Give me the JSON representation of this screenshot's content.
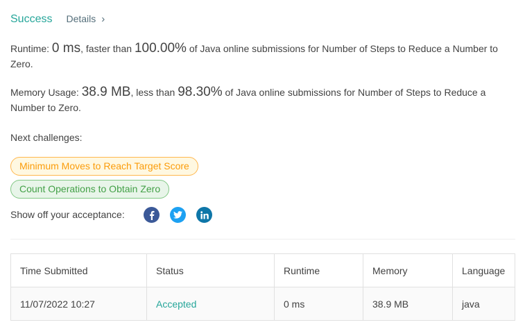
{
  "header": {
    "status": "Success",
    "details_label": "Details",
    "details_chevron": "›"
  },
  "runtime": {
    "label": "Runtime:",
    "value": "0 ms",
    "comparison": ", faster than",
    "percent": "100.00%",
    "suffix": "of Java online submissions for Number of Steps to Reduce a Number to Zero."
  },
  "memory": {
    "label": "Memory Usage:",
    "value": "38.9 MB",
    "comparison": ", less than",
    "percent": "98.30%",
    "suffix": "of Java online submissions for Number of Steps to Reduce a Number to Zero."
  },
  "next": {
    "label": "Next challenges:",
    "challenges": [
      {
        "title": "Minimum Moves to Reach Target Score",
        "difficulty_color": "#fb9c0a"
      },
      {
        "title": "Count Operations to Obtain Zero",
        "difficulty_color": "#43a047"
      }
    ]
  },
  "share": {
    "label": "Show off your acceptance:",
    "icons": [
      "facebook-icon",
      "twitter-icon",
      "linkedin-icon"
    ]
  },
  "table": {
    "headers": [
      "Time Submitted",
      "Status",
      "Runtime",
      "Memory",
      "Language"
    ],
    "rows": [
      [
        "11/07/2022 10:27",
        "Accepted",
        "0 ms",
        "38.9 MB",
        "java"
      ]
    ]
  },
  "colors": {
    "accent": "#26a69a",
    "orange": "#fb9c0a",
    "green": "#43a047"
  }
}
